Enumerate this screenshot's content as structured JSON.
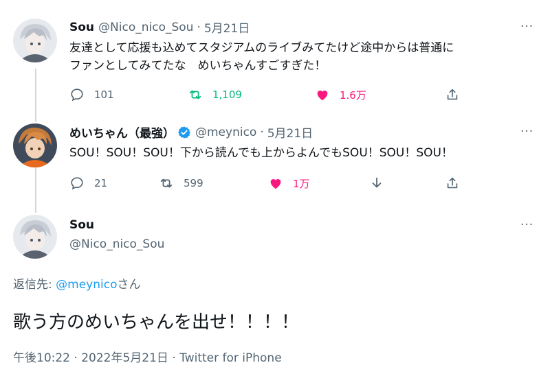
{
  "tweet1": {
    "name": "Sou",
    "handle": "@Nico_nico_Sou",
    "separator": "·",
    "date": "5月21日",
    "text_line1": "友達として応援も込めてスタジアムのライブみてたけど途中からは普通に",
    "text_line2": "ファンとしてみてたな　めいちゃんすごすぎた！",
    "more": "···",
    "replies": "101",
    "retweets": "1,109",
    "likes": "1.6万"
  },
  "tweet2": {
    "name": "めいちゃん（最強）",
    "handle": "@meynico",
    "separator": "·",
    "date": "5月21日",
    "text": "SOU！SOU！SOU！下から読んでも上からよんでもSOU！SOU！SOU！",
    "more": "···",
    "replies": "21",
    "retweets": "599",
    "likes": "1万"
  },
  "main_tweet": {
    "name": "Sou",
    "handle": "@Nico_nico_Sou",
    "more": "···",
    "reply_prefix": "返信先: ",
    "reply_handle": "@meynico",
    "reply_suffix": "さん",
    "text": "歌う方のめいちゃんを出せ！！！！",
    "meta": "午後10:22 · 2022年5月21日 · Twitter for iPhone"
  },
  "colors": {
    "retweet_active": "#00ba7c",
    "like_active": "#f91880",
    "link": "#1d9bf0",
    "secondary": "#536471"
  }
}
